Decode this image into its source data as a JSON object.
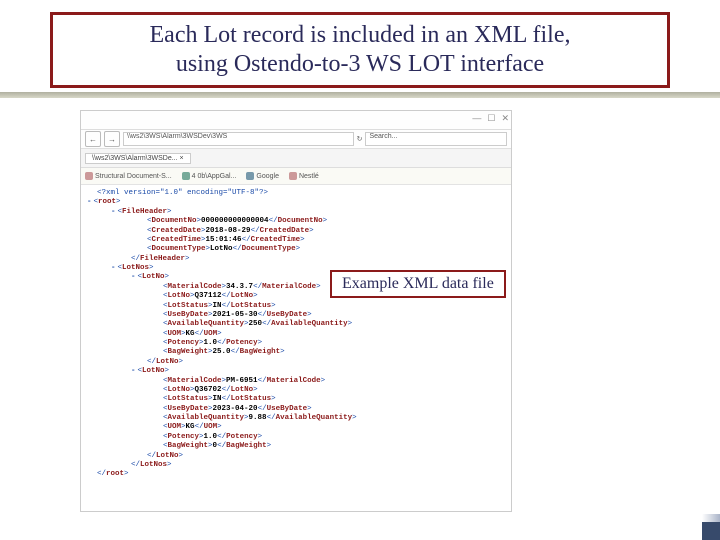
{
  "title_line1": "Each Lot record is included in an XML file,",
  "title_line2": "using Ostendo-to-3 WS LOT interface",
  "callout": "Example XML data file",
  "browser": {
    "address": "\\\\ws2\\3WS\\Alarm\\3WSDev\\3WS",
    "search_placeholder": "Search...",
    "tab": "\\\\ws2\\3WS\\Alarm\\3WSDe... ×",
    "favs": [
      "Structural Document-S...",
      "4 0b\\AppGal...",
      "Google",
      "Nestlé"
    ],
    "win": {
      "min": "—",
      "max": "☐",
      "close": "✕"
    }
  },
  "xml": {
    "pi": "<?xml version=\"1.0\" encoding=\"UTF-8\"?>",
    "root_open": "root",
    "fh_open": "FileHeader",
    "doc_no_tag": "DocumentNo",
    "doc_no_val": "000000000000004",
    "cdate_tag": "CreatedDate",
    "cdate_val": "2018-08-29",
    "ctime_tag": "CreatedTime",
    "ctime_val": "15:01:46",
    "dtype_tag": "DocumentType",
    "dtype_val": "LotNo",
    "fh_close": "FileHeader",
    "lotnos_open": "LotNos",
    "lotno_open": "LotNo",
    "lot1": {
      "mat_tag": "MaterialCode",
      "mat_val": "34.3.7",
      "lot_tag": "LotNo",
      "lot_val": "Q37112",
      "stat_tag": "LotStatus",
      "stat_val": "IN",
      "use_tag": "UseByDate",
      "use_val": "2021-05-30",
      "qty_tag": "AvailableQuantity",
      "qty_val": "250",
      "uom_tag": "UOM",
      "uom_val": "KG",
      "pot_tag": "Potency",
      "pot_val": "1.0",
      "bag_tag": "BagWeight",
      "bag_val": "25.0"
    },
    "lot2": {
      "mat_tag": "MaterialCode",
      "mat_val": "PM-6951",
      "lot_tag": "LotNo",
      "lot_val": "Q36702",
      "stat_tag": "LotStatus",
      "stat_val": "IN",
      "use_tag": "UseByDate",
      "use_val": "2023-04-20",
      "qty_tag": "AvailableQuantity",
      "qty_val": "9.88",
      "uom_tag": "UOM",
      "uom_val": "KG",
      "pot_tag": "Potency",
      "pot_val": "1.0",
      "bag_tag": "BagWeight",
      "bag_val": "0"
    },
    "lotno_close": "LotNo",
    "lotnos_close": "LotNos",
    "root_close": "root"
  }
}
